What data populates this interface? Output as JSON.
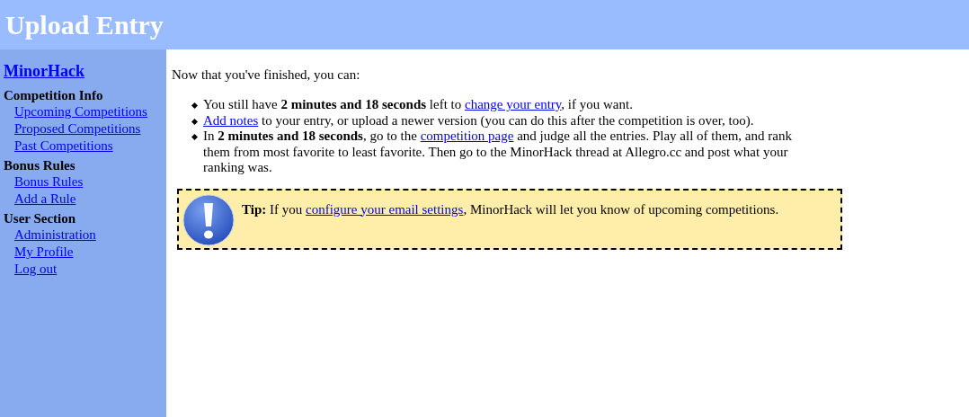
{
  "header": {
    "title": "Upload Entry"
  },
  "sidebar": {
    "site_link": "MinorHack",
    "sections": [
      {
        "heading": "Competition Info",
        "links": [
          "Upcoming Competitions",
          "Proposed Competitions",
          "Past Competitions"
        ]
      },
      {
        "heading": "Bonus Rules",
        "links": [
          "Bonus Rules",
          "Add a Rule"
        ]
      },
      {
        "heading": "User Section",
        "links": [
          "Administration",
          "My Profile",
          "Log out"
        ]
      }
    ]
  },
  "main": {
    "intro": "Now that you've finished, you can:",
    "items": [
      [
        {
          "kind": "text",
          "text": "You still have **2 minutes and 18 seconds** left to "
        },
        {
          "kind": "link",
          "text": "change your entry"
        },
        {
          "kind": "text",
          "text": ", if you want."
        }
      ],
      [
        {
          "kind": "link",
          "text": "Add notes"
        },
        {
          "kind": "text",
          "text": " to your entry, or upload a newer version (you can do this after the competition is over, too)."
        }
      ],
      [
        {
          "kind": "text",
          "text": "In **2 minutes and 18 seconds**, go to the "
        },
        {
          "kind": "link",
          "text": "competition page"
        },
        {
          "kind": "text",
          "text": " and judge all the entries. Play all of them, and rank them from most favorite to least favorite. Then go to the MinorHack thread at Allegro.cc and post what your ranking was."
        }
      ]
    ],
    "tip": [
      {
        "kind": "text",
        "text": "**Tip:** If you "
      },
      {
        "kind": "link",
        "text": "configure your email settings"
      },
      {
        "kind": "text",
        "text": ", MinorHack will let you know of upcoming competitions."
      }
    ]
  }
}
